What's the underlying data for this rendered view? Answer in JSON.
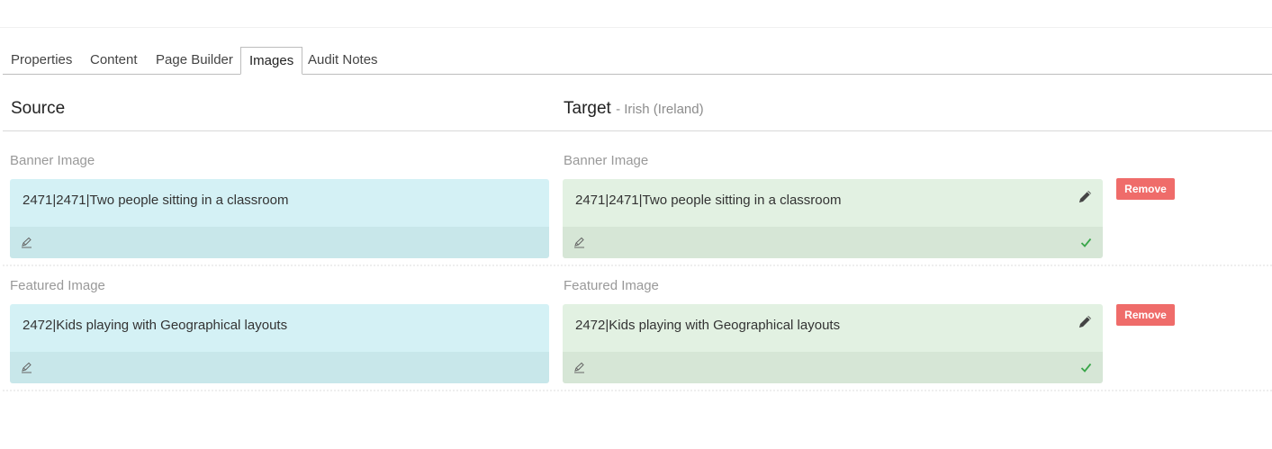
{
  "tabs": [
    {
      "label": "Properties"
    },
    {
      "label": "Content"
    },
    {
      "label": "Page Builder"
    },
    {
      "label": "Images"
    },
    {
      "label": "Audit Notes"
    }
  ],
  "active_tab": "Images",
  "source": {
    "title": "Source"
  },
  "target": {
    "title": "Target",
    "language": "- Irish (Ireland)"
  },
  "fields": [
    {
      "label": "Banner Image",
      "source_value": "2471|2471|Two people sitting in a classroom",
      "target_value": "2471|2471|Two people sitting in a classroom",
      "remove_label": "Remove"
    },
    {
      "label": "Featured Image",
      "source_value": "2472|Kids playing with Geographical layouts",
      "target_value": "2472|Kids playing with Geographical layouts",
      "remove_label": "Remove"
    }
  ],
  "icons": {
    "source_footer": "edit-translate-icon",
    "target_footer": "edit-translate-icon",
    "edit": "pencil-icon",
    "status": "check-icon"
  },
  "colors": {
    "source_bg": "#d4f1f5",
    "target_bg": "#e2f1e2",
    "remove": "#ef6c6a",
    "check": "#3aa64a"
  }
}
